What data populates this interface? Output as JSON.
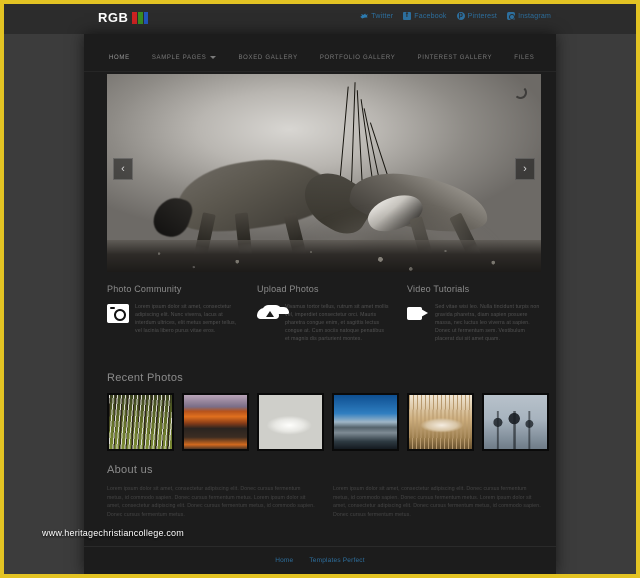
{
  "theme": {
    "page_border_color": "#e3c323",
    "outer_bg": "#3c3c3c",
    "site_bg": "#1c1c1c",
    "topbar_bg": "#2c2c2c",
    "link_blue": "#2d6f9e",
    "heading_gray": "#8c8c8c",
    "body_gray": "#525252"
  },
  "topbar": {
    "logo": {
      "text": "RGB",
      "bar_red": "#cc2222",
      "bar_green": "#3b8c22",
      "bar_blue": "#2255bb"
    },
    "social": [
      {
        "label": "Twitter",
        "icon": "twitter-icon"
      },
      {
        "label": "Facebook",
        "icon": "facebook-icon"
      },
      {
        "label": "Pinterest",
        "icon": "pinterest-icon"
      },
      {
        "label": "Instagram",
        "icon": "instagram-icon"
      }
    ]
  },
  "nav": {
    "items": [
      {
        "label": "HOME",
        "has_dropdown": false
      },
      {
        "label": "SAMPLE PAGES",
        "has_dropdown": true
      },
      {
        "label": "BOXED GALLERY",
        "has_dropdown": false
      },
      {
        "label": "PORTFOLIO GALLERY",
        "has_dropdown": false
      },
      {
        "label": "PINTEREST GALLERY",
        "has_dropdown": false
      },
      {
        "label": "FILES",
        "has_dropdown": false
      }
    ]
  },
  "hero": {
    "alt": "Two oryx antelope fighting in dust, black and white photograph",
    "prev_label": "‹",
    "next_label": "›",
    "spinner": "loading-spinner"
  },
  "features": [
    {
      "title": "Photo Community",
      "icon": "camera-icon",
      "text": "Lorem ipsum dolor sit amet, consectetur adipiscing elit. Nunc viverra, lacus at interdum ultrices, elit metus semper tellus, vel lacinia libero purus vitae eros."
    },
    {
      "title": "Upload Photos",
      "icon": "cloud-upload-icon",
      "text": "Vivamus tortor tellus, rutrum sit amet mollis vel, imperdiet consectetur orci. Mauris pharetra congue enim, et sagittis lectus congue at. Cum sociis natoque penatibus et magnis dis parturient montes."
    },
    {
      "title": "Video Tutorials",
      "icon": "video-camera-icon",
      "text": "Sed vitae wisi leo. Nulla tincidunt turpis non gravida pharetra, diam sapien posuere massa, nec luctus leo viverra at sapien. Donec ut fermentum sem. Vestibulum placerat dui sit amet quam."
    }
  ],
  "recent_photos": {
    "title": "Recent Photos",
    "thumbnails": [
      {
        "caption": "Aspen forest with green undergrowth"
      },
      {
        "caption": "Orange alpenglow mountain over lake"
      },
      {
        "caption": "White snow and ice texture abstract"
      },
      {
        "caption": "Deep blue sky over snowy lake shore"
      },
      {
        "caption": "Sepia toned reed field in mist"
      },
      {
        "caption": "Bare winter trees against grey sky"
      }
    ]
  },
  "about": {
    "title": "About us",
    "columns": [
      "Lorem ipsum dolor sit amet, consectetur adipiscing elit. Donec cursus fermentum metus, id commodo sapien. Donec cursus fermentum metus. Lorem ipsum dolor sit amet, consectetur adipiscing elit. Donec cursus fermentum metus, id commodo sapien. Donec cursus fermentum metus.",
      "Lorem ipsum dolor sit amet, consectetur adipiscing elit. Donec cursus fermentum metus, id commodo sapien. Donec cursus fermentum metus. Lorem ipsum dolor sit amet, consectetur adipiscing elit. Donec cursus fermentum metus, id commodo sapien. Donec cursus fermentum metus."
    ]
  },
  "footer": {
    "links": [
      {
        "label": "Home"
      },
      {
        "label": "Templates Perfect"
      }
    ]
  },
  "watermark": {
    "text": "www.heritagechristiancollege.com"
  }
}
